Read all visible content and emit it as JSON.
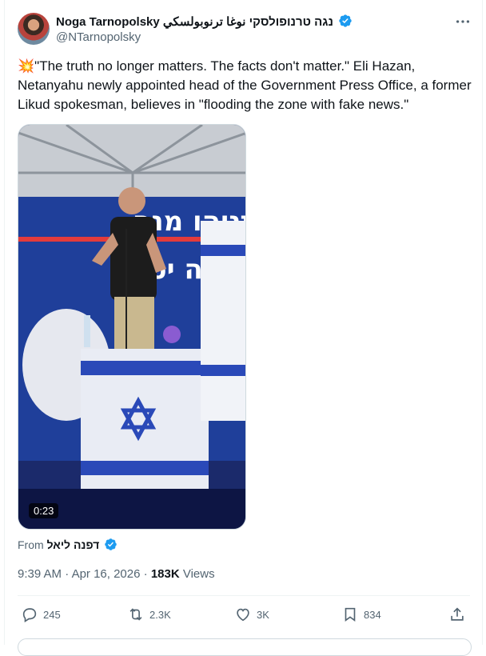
{
  "author": {
    "name": "Noga Tarnopolsky נגה טרנופולסקי نوغا ترنوبولسكي",
    "handle": "@NTarnopolsky"
  },
  "tweet": {
    "text": "💥\"The truth no longer matters. The facts don't matter.\" Eli Hazan, Netanyahu newly appointed head of the Government Press Office, a former Likud spokesman, believes in \"flooding the zone with fake news.\""
  },
  "media": {
    "duration": "0:23",
    "banner_text_1": "נתניהו מנה",
    "banner_text_2": "לעוצמה יטוח"
  },
  "source": {
    "prefix": "From",
    "name": "דפנה ליאל"
  },
  "meta": {
    "time": "9:39 AM",
    "separator": "·",
    "date": "Apr 16, 2026",
    "views_count": "183K",
    "views_label": "Views"
  },
  "actions": {
    "replies": "245",
    "reposts": "2.3K",
    "likes": "3K",
    "bookmarks": "834"
  },
  "colors": {
    "verified": "#1d9bf0",
    "muted": "#536471"
  }
}
